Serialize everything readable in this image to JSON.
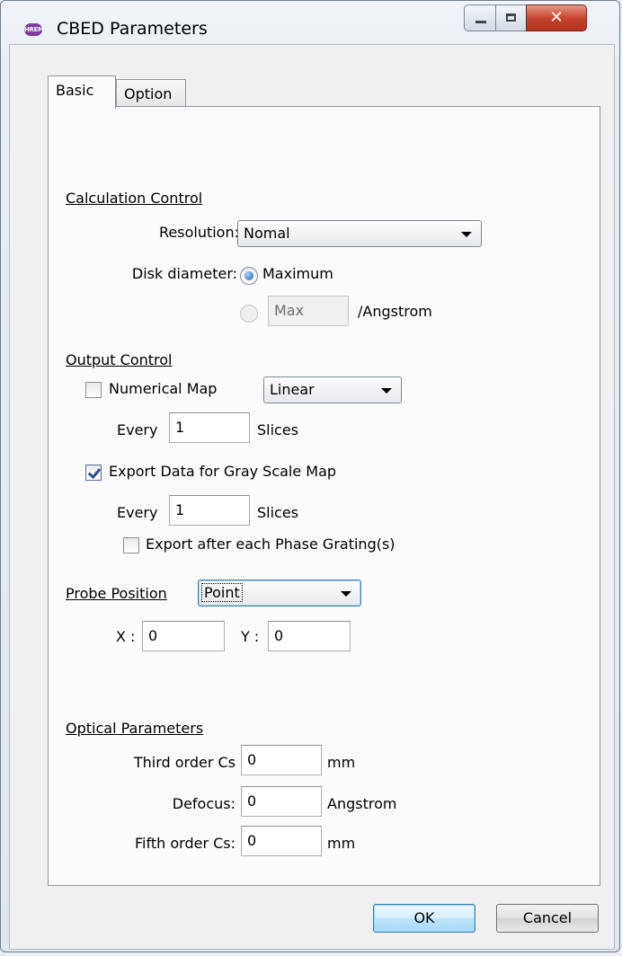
{
  "window": {
    "title": "CBED Parameters",
    "app_icon_text": "HREM"
  },
  "tabs": [
    {
      "label": "Basic"
    },
    {
      "label": "Option"
    }
  ],
  "calc": {
    "heading": "Calculation Control",
    "resolution_label": "Resolution:",
    "resolution_value": "Nomal",
    "disk_label": "Disk diameter:",
    "disk_max_label": "Maximum",
    "disk_custom_value": "Max",
    "disk_unit": "/Angstrom"
  },
  "output": {
    "heading": "Output Control",
    "numerical_map_label": "Numerical Map",
    "numerical_map_checked": false,
    "scale_value": "Linear",
    "every1_label": "Every",
    "every1_value": "1",
    "slices1_label": "Slices",
    "gray_label": "Export Data for Gray Scale Map",
    "gray_checked": true,
    "every2_label": "Every",
    "every2_value": "1",
    "slices2_label": "Slices",
    "phase_label": "Export after each Phase Grating(s)",
    "phase_checked": false
  },
  "probe": {
    "heading": "Probe Position",
    "mode_value": "Point",
    "x_label": "X :",
    "x_value": "0",
    "y_label": "Y :",
    "y_value": "0"
  },
  "optical": {
    "heading": "Optical Parameters",
    "cs3_label": "Third order Cs",
    "cs3_value": "0",
    "cs3_unit": "mm",
    "defocus_label": "Defocus:",
    "defocus_value": "0",
    "defocus_unit": "Angstrom",
    "cs5_label": "Fifth order Cs:",
    "cs5_value": "0",
    "cs5_unit": "mm"
  },
  "buttons": {
    "ok": "OK",
    "cancel": "Cancel"
  }
}
